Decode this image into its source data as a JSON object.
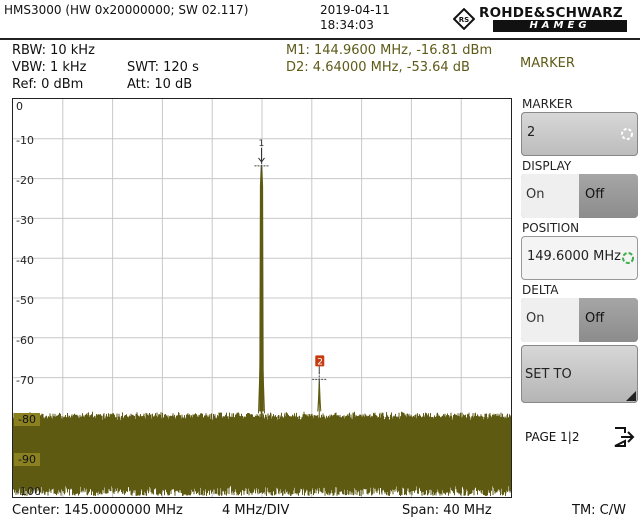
{
  "header": {
    "device": "HMS3000 (HW 0x20000000; SW 02.117)",
    "date": "2019-04-11",
    "time": "18:34:03",
    "brand_top": "ROHDE&SCHWARZ",
    "brand_bottom": "HAMEG"
  },
  "settings": {
    "rbw": "RBW: 10 kHz",
    "vbw": "VBW: 1 kHz",
    "swt": "SWT: 120 s",
    "ref": "Ref: 0 dBm",
    "att": "Att: 10 dB"
  },
  "markers": {
    "m1": "M1: 144.9600 MHz, -16.81 dBm",
    "d2": "D2: 4.64000 MHz, -53.64 dB"
  },
  "menu": {
    "title": "MARKER",
    "marker_label": "MARKER",
    "marker_value": "2",
    "display_label": "DISPLAY",
    "display_on": "On",
    "display_off": "Off",
    "position_label": "POSITION",
    "position_value": "149.6000 MHz",
    "delta_label": "DELTA",
    "delta_on": "On",
    "delta_off": "Off",
    "set_to": "SET TO",
    "page": "PAGE 1|2"
  },
  "footer": {
    "center": "Center: 145.0000000 MHz",
    "div": "4 MHz/DIV",
    "span": "Span: 40 MHz",
    "tm": "TM: C/W"
  },
  "colors": {
    "trace": "#5e5a12",
    "marker2": "#c83a10",
    "grid": "#c8c8c8",
    "accent_olive": "#8a8020"
  },
  "chart_data": {
    "type": "line",
    "xlabel": "",
    "ylabel": "",
    "x_range_mhz": [
      125,
      165
    ],
    "ylim": [
      -100,
      0
    ],
    "y_ticks": [
      "0",
      "-10",
      "-20",
      "-30",
      "-40",
      "-50",
      "-60",
      "-70",
      "-80",
      "-90",
      "-100"
    ],
    "grid": true,
    "noise_floor_dbm": -80,
    "noise_min_dbm": -100,
    "markers": [
      {
        "label": "1",
        "x_mhz": 144.96,
        "y_dbm": -16.81
      },
      {
        "label": "2",
        "x_mhz": 149.6,
        "y_dbm": -70.45
      }
    ],
    "peaks": [
      {
        "x_mhz": 144.96,
        "y_dbm": -16.81
      },
      {
        "x_mhz": 149.6,
        "y_dbm": -70.45
      }
    ]
  }
}
